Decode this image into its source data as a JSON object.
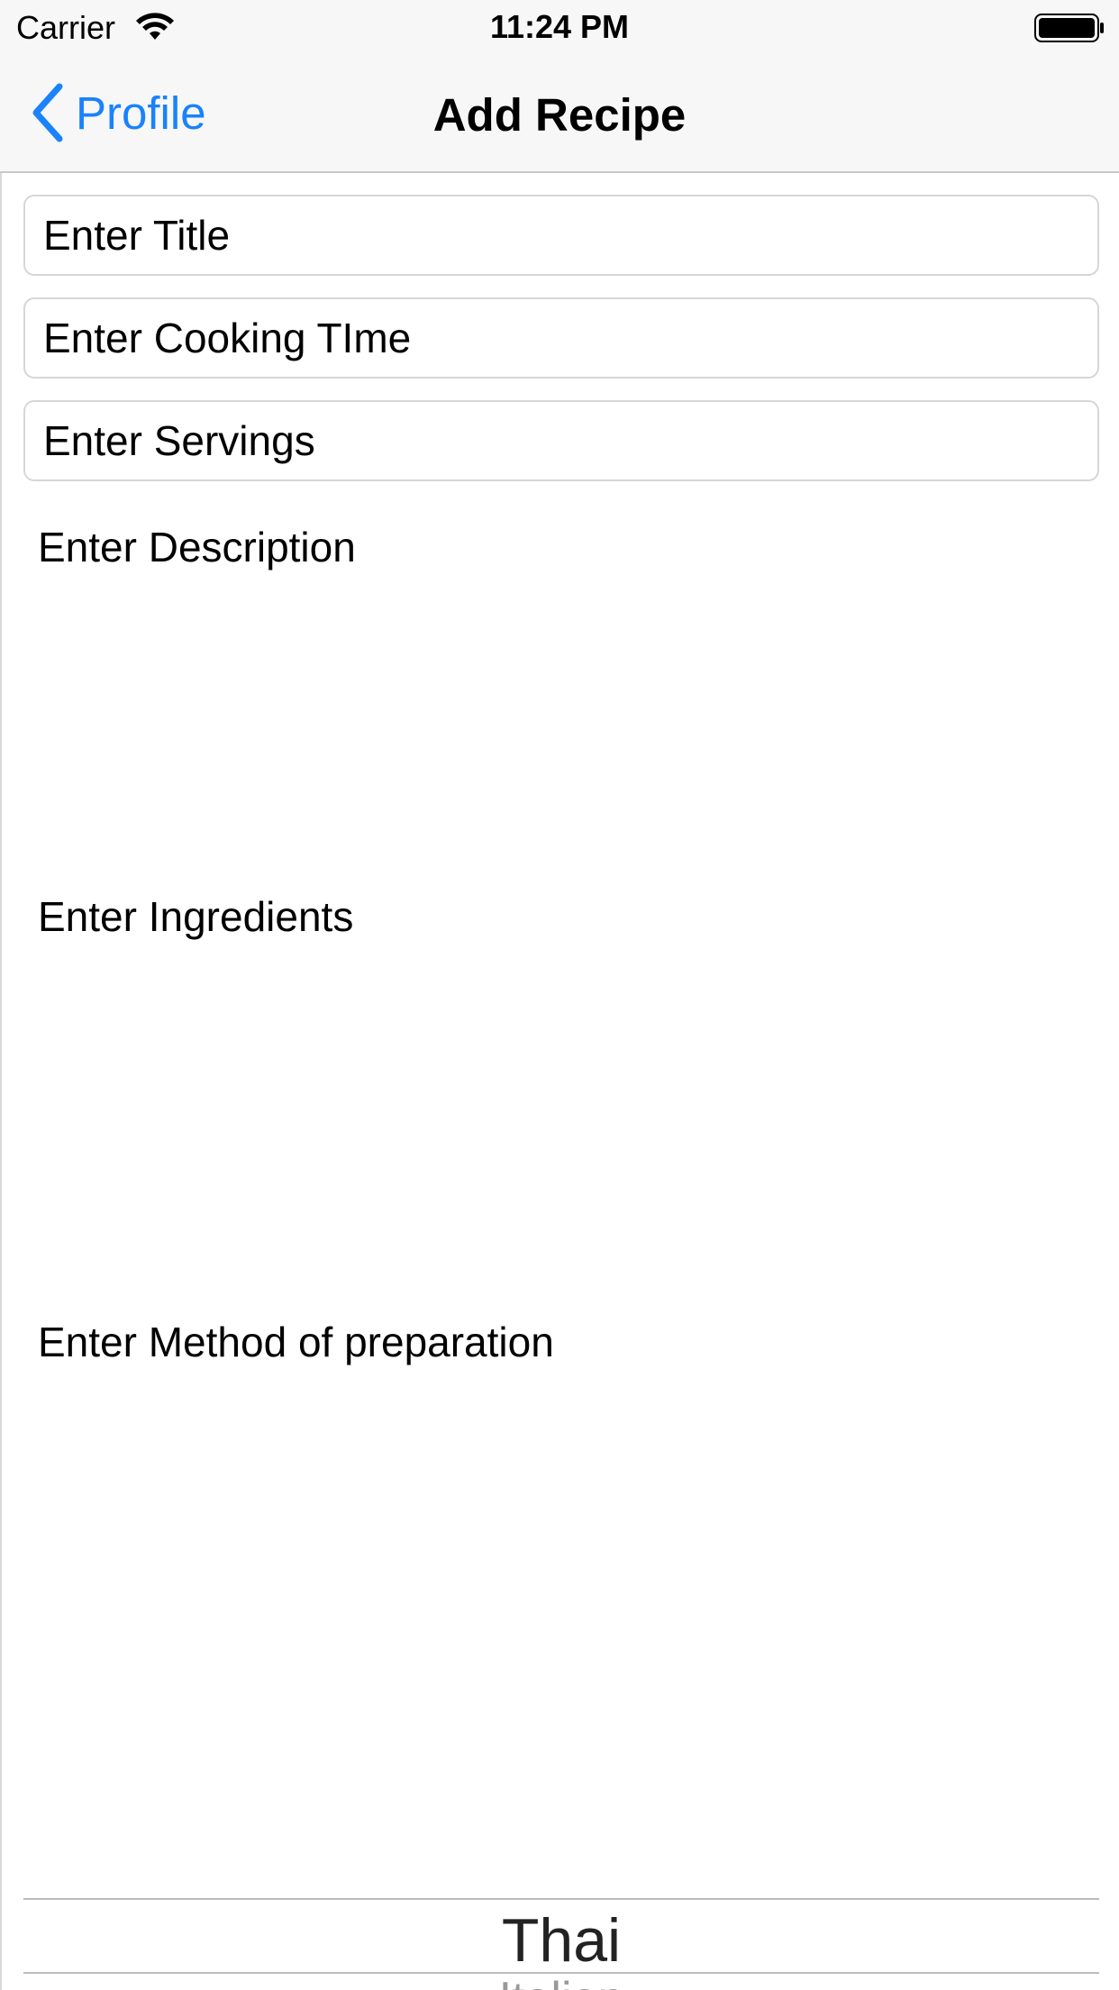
{
  "status_bar": {
    "carrier": "Carrier",
    "time": "11:24 PM",
    "icons": [
      "wifi-icon",
      "battery-icon"
    ]
  },
  "nav": {
    "back_label": "Profile",
    "title": "Add Recipe",
    "accent_color": "#1a82fb"
  },
  "form": {
    "title_placeholder": "Enter Title",
    "cooking_time_placeholder": "Enter Cooking TIme",
    "servings_placeholder": "Enter Servings",
    "description_label": "Enter Description",
    "ingredients_label": "Enter Ingredients",
    "method_label": "Enter Method of preparation"
  },
  "picker": {
    "selected": "Thai",
    "next": "Italian"
  }
}
